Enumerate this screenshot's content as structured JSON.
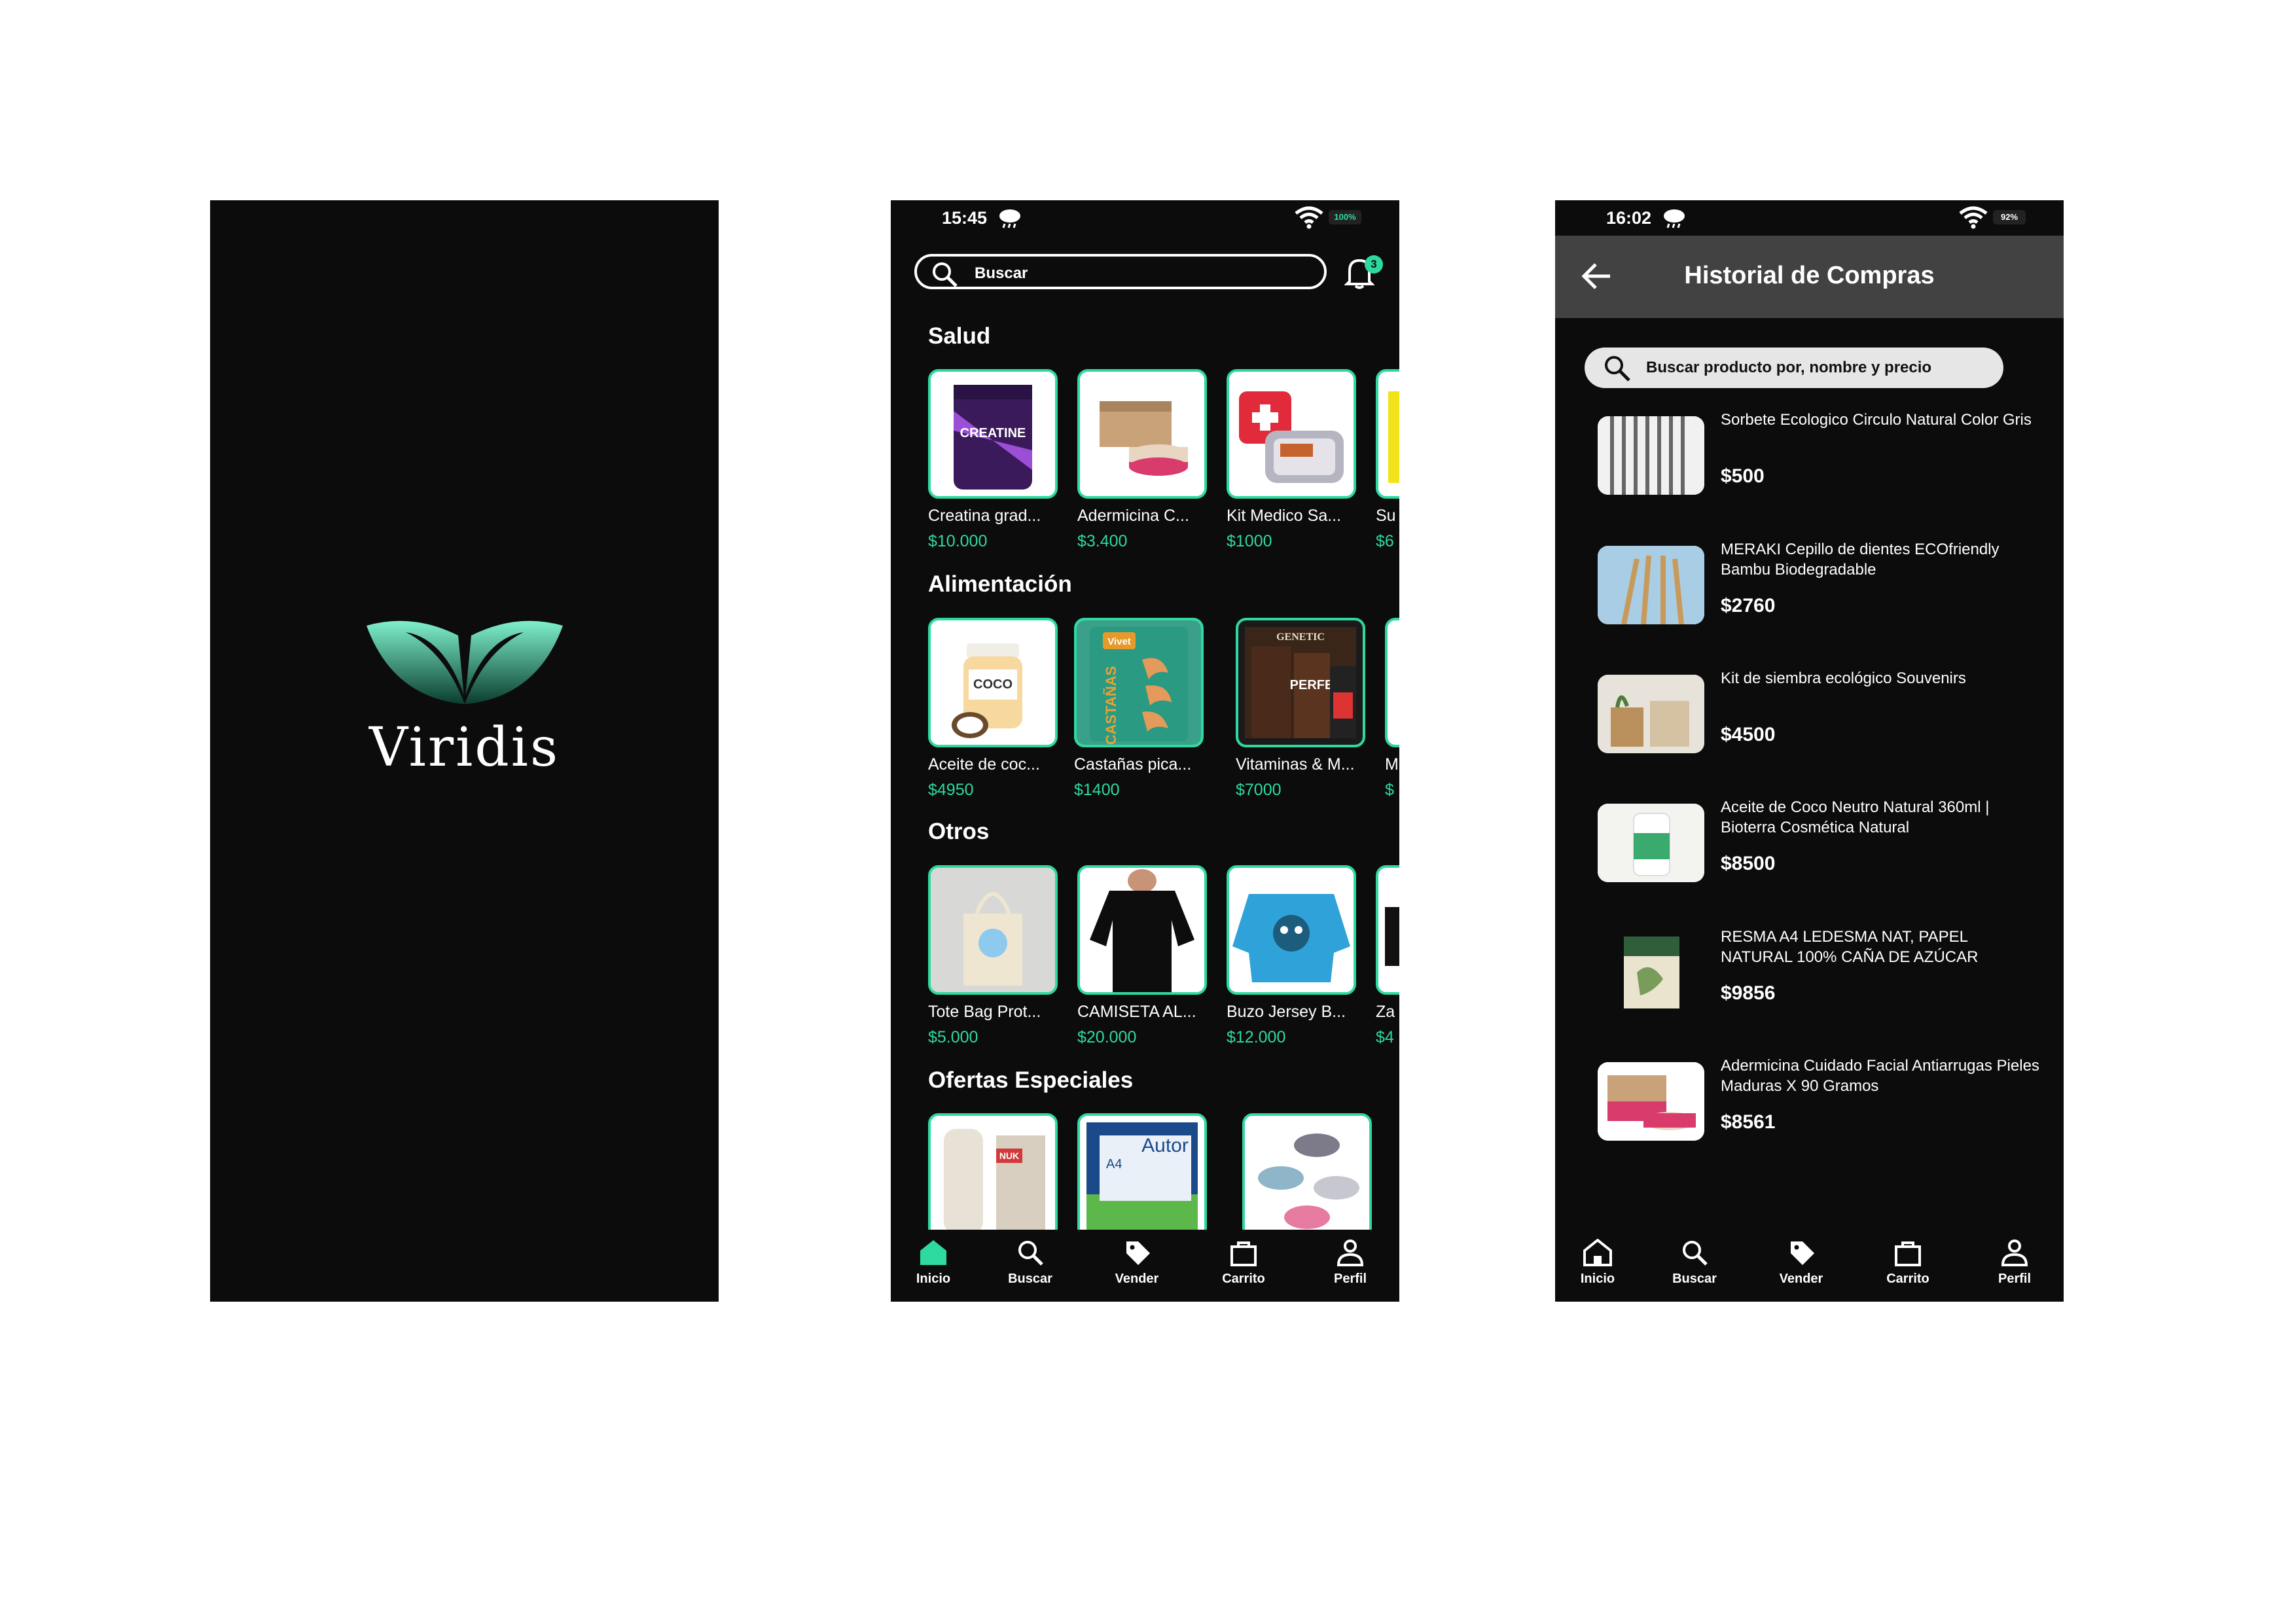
{
  "splash": {
    "brand": "Viridis"
  },
  "home": {
    "status": {
      "time": "15:45",
      "battery": "100%"
    },
    "search_placeholder": "Buscar",
    "notification_count": "3",
    "sections": [
      {
        "title": "Salud",
        "products": [
          {
            "name": "Creatina grad...",
            "price": "$10.000"
          },
          {
            "name": "Adermicina C...",
            "price": "$3.400"
          },
          {
            "name": "Kit Medico Sa...",
            "price": "$1000"
          },
          {
            "name": "Su",
            "price": "$6"
          }
        ]
      },
      {
        "title": "Alimentación",
        "products": [
          {
            "name": "Aceite de coc...",
            "price": "$4950"
          },
          {
            "name": "Castañas pica...",
            "price": "$1400"
          },
          {
            "name": "Vitaminas & M...",
            "price": "$7000"
          },
          {
            "name": "M",
            "price": "$"
          }
        ]
      },
      {
        "title": "Otros",
        "products": [
          {
            "name": "Tote Bag Prot...",
            "price": "$5.000"
          },
          {
            "name": "CAMISETA AL...",
            "price": "$20.000"
          },
          {
            "name": "Buzo Jersey B...",
            "price": "$12.000"
          },
          {
            "name": "Za",
            "price": "$4"
          }
        ]
      },
      {
        "title": "Ofertas Especiales",
        "products": []
      }
    ],
    "image_texts": {
      "creatine": "CREATINE",
      "coco": "COCO",
      "castanas": "CASTAÑAS",
      "vivet": "Vivet",
      "genetic": "GENETIC",
      "perfect": "PERFE",
      "autor": "Autor",
      "a4": "A4",
      "nuk": "NUK"
    }
  },
  "nav": [
    "Inicio",
    "Buscar",
    "Vender",
    "Carrito",
    "Perfil"
  ],
  "history": {
    "status": {
      "time": "16:02",
      "battery": "92%"
    },
    "title": "Historial de Compras",
    "search_placeholder": "Buscar producto por, nombre y precio",
    "items": [
      {
        "desc": "Sorbete Ecologico Circulo Natural Color Gris",
        "price": "$500"
      },
      {
        "desc": "MERAKI Cepillo de dientes ECOfriendly Bambu Biodegradable",
        "price": "$2760"
      },
      {
        "desc": "Kit de siembra ecológico Souvenirs",
        "price": "$4500"
      },
      {
        "desc": "Aceite de Coco Neutro Natural 360ml | Bioterra Cosmética Natural",
        "price": "$8500"
      },
      {
        "desc": "RESMA A4 LEDESMA NAT, PAPEL NATURAL 100% CAÑA DE AZÚCAR",
        "price": "$9856"
      },
      {
        "desc": "Adermicina Cuidado Facial Antiarrugas Pieles Maduras X 90 Gramos",
        "price": "$8561"
      }
    ]
  },
  "colors": {
    "accent": "#2ed9a0",
    "background": "#0c0c0c",
    "header": "#424242"
  }
}
